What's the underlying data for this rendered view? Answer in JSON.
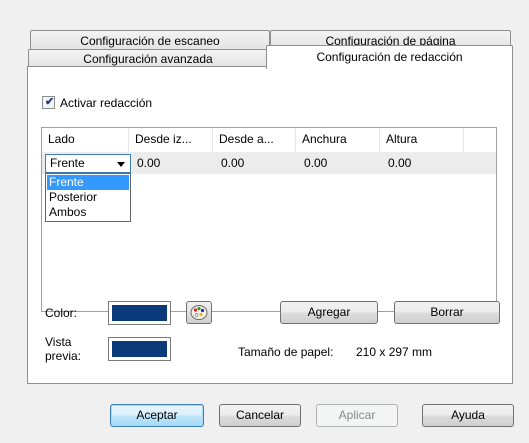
{
  "tabs": {
    "row_back": [
      "Configuración de escaneo",
      "Configuración de página"
    ],
    "row_front": [
      "Configuración avanzada",
      "Configuración de redacción"
    ]
  },
  "enable": {
    "label": "Activar redacción",
    "checked": true
  },
  "grid": {
    "columns": [
      "Lado",
      "Desde iz...",
      "Desde a...",
      "Anchura",
      "Altura"
    ],
    "row": {
      "side": "Frente",
      "values": [
        "0.00",
        "0.00",
        "0.00",
        "0.00"
      ]
    },
    "side_options": [
      "Frente",
      "Posterior",
      "Ambos"
    ]
  },
  "color": {
    "label": "Color:",
    "value": "#0a3a7a"
  },
  "preview": {
    "label_line1": "Vista",
    "label_line2": "previa:",
    "value": "#0a3a7a"
  },
  "buttons": {
    "add": "Agregar",
    "delete": "Borrar"
  },
  "paper": {
    "label": "Tamaño de papel:",
    "value": "210 x 297 mm"
  },
  "footer": {
    "ok": "Aceptar",
    "cancel": "Cancelar",
    "apply": "Aplicar",
    "help": "Ayuda"
  }
}
